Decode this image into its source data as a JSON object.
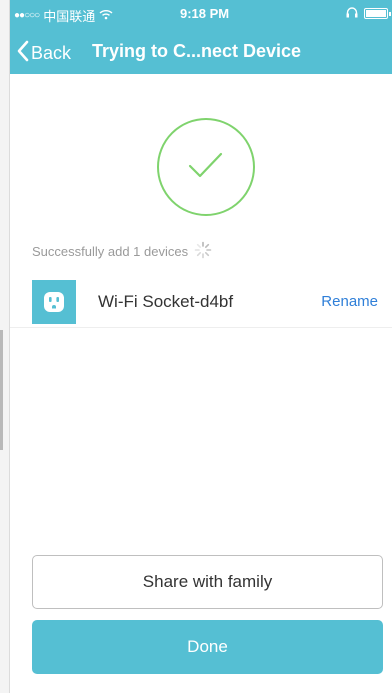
{
  "status_bar": {
    "signal_dots": "●●○○○",
    "carrier": "中国联通",
    "wifi_icon": "wifi-icon",
    "time": "9:18 PM",
    "headphones_icon": "headphones-icon",
    "battery_level": 1.0
  },
  "nav": {
    "back_label": "Back",
    "title": "Trying to C...nect Device"
  },
  "result": {
    "success_icon": "checkmark-icon",
    "status_text": "Successfully add 1 devices",
    "spinner_icon": "spinner-icon"
  },
  "devices": [
    {
      "icon": "socket-icon",
      "name": "Wi-Fi Socket-d4bf",
      "action_label": "Rename"
    }
  ],
  "actions": {
    "share_label": "Share with family",
    "done_label": "Done"
  },
  "colors": {
    "accent": "#55bfd3",
    "success": "#7fd36d",
    "link": "#2f7fd8"
  }
}
